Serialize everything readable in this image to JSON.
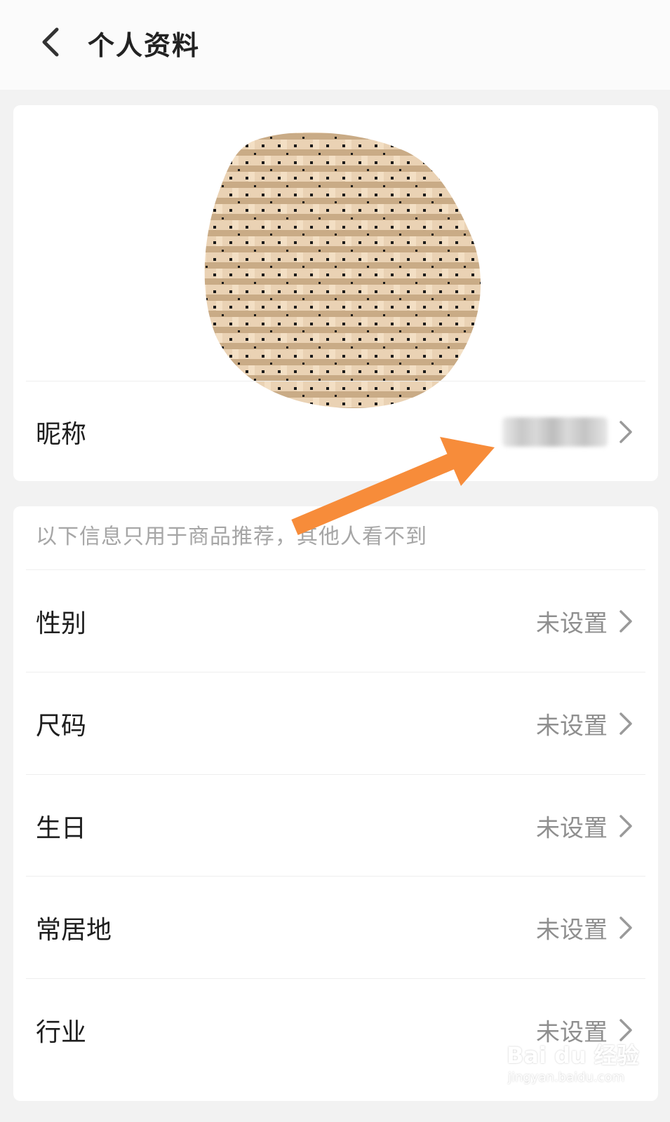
{
  "header": {
    "title": "个人资料",
    "back_icon": "chevron-left-icon"
  },
  "profile": {
    "avatar_desc": "woven-pattern-avatar",
    "nickname_label": "昵称"
  },
  "info": {
    "notice": "以下信息只用于商品推荐，其他人看不到",
    "items": [
      {
        "label": "性别",
        "value": "未设置"
      },
      {
        "label": "尺码",
        "value": "未设置"
      },
      {
        "label": "生日",
        "value": "未设置"
      },
      {
        "label": "常居地",
        "value": "未设置"
      },
      {
        "label": "行业",
        "value": "未设置"
      }
    ]
  },
  "annotation": {
    "arrow_color": "#f78c3a"
  },
  "watermark": {
    "brand": "Bai du 经验",
    "url": "jingyan.baidu.com"
  },
  "colors": {
    "background": "#f2f2f2",
    "card": "#ffffff",
    "muted_text": "#8f8f8f"
  }
}
